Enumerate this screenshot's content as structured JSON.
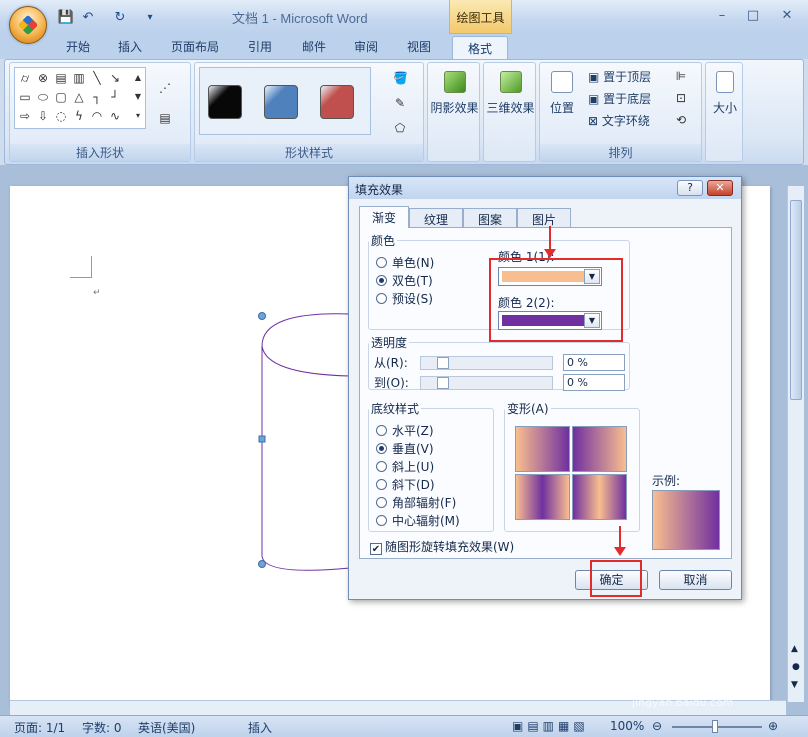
{
  "window": {
    "title": "文档 1 - Microsoft Word",
    "context_group": "绘图工具",
    "minimize": "–",
    "maximize": "□",
    "close": "✕"
  },
  "quick_access": {
    "save": "💾",
    "undo": "↶",
    "redo": "↻",
    "customize": "▾"
  },
  "tabs": [
    "开始",
    "插入",
    "页面布局",
    "引用",
    "邮件",
    "审阅",
    "视图"
  ],
  "active_tab": "格式",
  "ribbon": {
    "group_insert_shapes": "插入形状",
    "group_shape_styles": "形状样式",
    "shadow_effects": "阴影效果",
    "three_d_effects": "三维效果",
    "position": "位置",
    "bring_to_front": "置于顶层",
    "send_to_back": "置于底层",
    "text_wrapping": "文字环绕",
    "group_arrange": "排列",
    "size": "大小",
    "style_colors": [
      "#080808",
      "#4f81bd",
      "#c0504d"
    ]
  },
  "status": {
    "page": "页面: 1/1",
    "words": "字数: 0",
    "language": "英语(美国)",
    "mode": "插入",
    "zoom": "100%"
  },
  "dialog": {
    "title": "填充效果",
    "help": "?",
    "close": "✕",
    "tabs": [
      "渐变",
      "纹理",
      "图案",
      "图片"
    ],
    "active_tab": "渐变",
    "colors_legend": "颜色",
    "color_options": [
      "单色(N)",
      "双色(T)",
      "预设(S)"
    ],
    "selected_color_option": "双色(T)",
    "color1_label": "颜色 1(1):",
    "color1_value": "#f9be8f",
    "color2_label": "颜色 2(2):",
    "color2_value": "#7030a0",
    "transparency_legend": "透明度",
    "from_label": "从(R):",
    "from_value": "0 %",
    "to_label": "到(O):",
    "to_value": "0 %",
    "shading_legend": "底纹样式",
    "shading_options": [
      "水平(Z)",
      "垂直(V)",
      "斜上(U)",
      "斜下(D)",
      "角部辐射(F)",
      "中心辐射(M)"
    ],
    "selected_shading": "垂直(V)",
    "variants_legend": "变形(A)",
    "sample_label": "示例:",
    "rotate_checkbox": "随图形旋转填充效果(W)",
    "ok": "确定",
    "cancel": "取消"
  },
  "watermark": {
    "brand": "Baidu经验",
    "url": "jingyan.baidu.com"
  }
}
